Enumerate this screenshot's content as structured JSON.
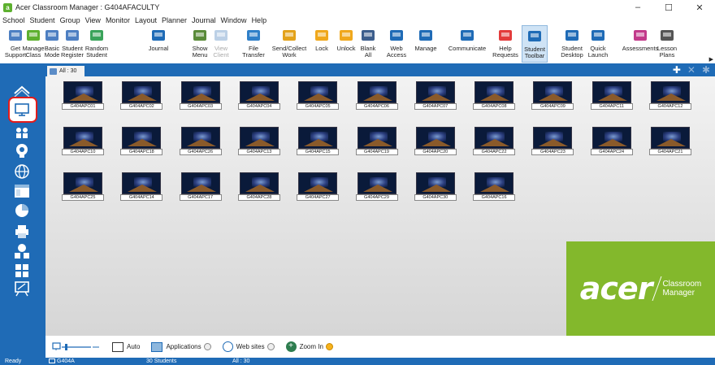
{
  "window": {
    "title": "Acer Classroom Manager : G404AFACULTY",
    "controls": [
      "–",
      "☐",
      "✕"
    ]
  },
  "menu": [
    "School",
    "Student",
    "Group",
    "View",
    "Monitor",
    "Layout",
    "Planner",
    "Journal",
    "Window",
    "Help"
  ],
  "ribbon": [
    {
      "label": "Get\nSupport",
      "icon": "support-icon"
    },
    {
      "label": "Manage\nClass",
      "icon": "manage-class-icon"
    },
    {
      "label": "Basic\nMode",
      "icon": "basic-mode-icon"
    },
    {
      "label": "Student\nRegister",
      "icon": "student-register-icon"
    },
    {
      "label": "Random\nStudent",
      "icon": "random-student-icon"
    },
    {
      "label": "Journal",
      "icon": "journal-icon"
    },
    {
      "label": "Show\nMenu",
      "icon": "show-menu-icon"
    },
    {
      "label": "View\nClient",
      "icon": "view-client-icon",
      "disabled": true
    },
    {
      "label": "File\nTransfer",
      "icon": "file-transfer-icon"
    },
    {
      "label": "Send/Collect\nWork",
      "icon": "send-collect-icon"
    },
    {
      "label": "Lock",
      "icon": "lock-icon"
    },
    {
      "label": "Unlock",
      "icon": "unlock-icon"
    },
    {
      "label": "Blank\nAll",
      "icon": "blank-all-icon"
    },
    {
      "label": "Web\nAccess",
      "icon": "web-access-icon"
    },
    {
      "label": "Manage",
      "icon": "manage-icon"
    },
    {
      "label": "Communicate",
      "icon": "communicate-icon"
    },
    {
      "label": "Help\nRequests",
      "icon": "help-requests-icon"
    },
    {
      "label": "Student\nToolbar",
      "icon": "student-toolbar-icon",
      "active": true
    },
    {
      "label": "Student\nDesktop",
      "icon": "student-desktop-icon"
    },
    {
      "label": "Quick\nLaunch",
      "icon": "quick-launch-icon"
    },
    {
      "label": "Assessments",
      "icon": "assessments-icon"
    },
    {
      "label": "Lesson\nPlans",
      "icon": "lesson-plans-icon"
    }
  ],
  "tab": {
    "label": "All : 30"
  },
  "computers": [
    "G404APC01",
    "G404APC02",
    "G404APC03",
    "G404APC04",
    "G404APC05",
    "G404APC06",
    "G404APC07",
    "G404APC08",
    "G404APC09",
    "G404APC11",
    "G404APC12",
    "G404APC10",
    "G404APC18",
    "G404APC26",
    "G404APC13",
    "G404APC15",
    "G404APC19",
    "G404APC20",
    "G404APC22",
    "G404APC23",
    "G404APC24",
    "G404APC21",
    "G404APC25",
    "G404APC14",
    "G404APC17",
    "G404APC28",
    "G404APC27",
    "G404APC29",
    "G404APC30",
    "G404APC16"
  ],
  "branding": {
    "word": "acer",
    "product_line1": "Classroom",
    "product_line2": "Manager"
  },
  "bottom": {
    "auto_label": "Auto",
    "applications_label": "Applications",
    "websites_label": "Web sites",
    "zoom_label": "Zoom In"
  },
  "status": {
    "ready": "Ready",
    "room": "G404A",
    "students": "30 Students",
    "group": "All : 30"
  },
  "colors": {
    "accent_blue": "#1f6bb6",
    "acer_green": "#83b82c",
    "highlight_red": "#e21b1b"
  }
}
